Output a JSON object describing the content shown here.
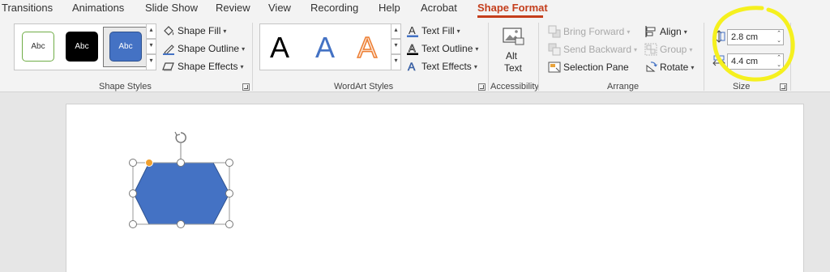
{
  "tabs": [
    "Transitions",
    "Animations",
    "Slide Show",
    "Review",
    "View",
    "Recording",
    "Help",
    "Acrobat",
    "Shape Format"
  ],
  "active_tab": "Shape Format",
  "shape_styles": {
    "swatches": [
      "Abc",
      "Abc",
      "Abc"
    ],
    "fill_label": "Shape Fill",
    "outline_label": "Shape Outline",
    "effects_label": "Shape Effects",
    "group_label": "Shape Styles"
  },
  "wordart": {
    "letters": [
      "A",
      "A",
      "A"
    ],
    "fill_label": "Text Fill",
    "outline_label": "Text Outline",
    "effects_label": "Text Effects",
    "group_label": "WordArt Styles"
  },
  "accessibility": {
    "alt_text_line1": "Alt",
    "alt_text_line2": "Text",
    "group_label": "Accessibility"
  },
  "arrange": {
    "bring_forward": "Bring Forward",
    "send_backward": "Send Backward",
    "selection_pane": "Selection Pane",
    "align": "Align",
    "group": "Group",
    "rotate": "Rotate",
    "group_label": "Arrange"
  },
  "size": {
    "height_value": "2.8 cm",
    "width_value": "4.4 cm",
    "group_label": "Size"
  },
  "colors": {
    "accent": "#c43e1c",
    "shape_fill": "#4472c4",
    "highlight": "#f5f01e"
  }
}
